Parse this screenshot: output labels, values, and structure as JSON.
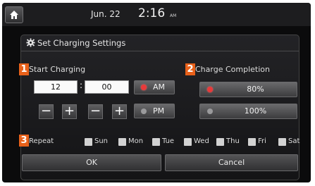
{
  "status_bar": {
    "date": "Jun. 22",
    "time": "2:16",
    "ampm": "AM"
  },
  "icons": {
    "home": "home-icon",
    "settings": "gear-icon"
  },
  "panel": {
    "title": "Set Charging Settings"
  },
  "start_charging": {
    "badge": "1",
    "label": "Start Charging",
    "hour": "12",
    "minute": "00",
    "am_label": "AM",
    "pm_label": "PM",
    "selected_period": "AM",
    "minus_symbol": "−",
    "plus_symbol": "+"
  },
  "charge_completion": {
    "badge": "2",
    "label": "Charge Completion",
    "options": [
      "80%",
      "100%"
    ],
    "selected": "80%"
  },
  "repeat": {
    "badge": "3",
    "label": "Repeat",
    "days": [
      "Sun",
      "Mon",
      "Tue",
      "Wed",
      "Thu",
      "Fri",
      "Sat"
    ]
  },
  "buttons": {
    "ok": "OK",
    "cancel": "Cancel"
  },
  "colors": {
    "accent_orange": "#e8611a",
    "selected_red": "#e83a3a",
    "unselected_grey": "#9a9a9c"
  }
}
